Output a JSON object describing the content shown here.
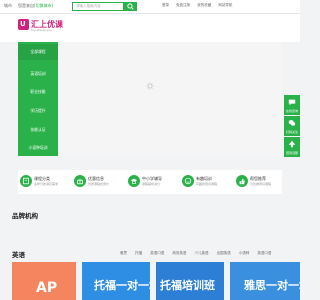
{
  "topbar": {
    "city": "城市",
    "switch_prefix": "您是来自",
    "switch_city": "[切换城市]",
    "search_placeholder": "请输入搜索内容",
    "links": [
      "登录",
      "免费注册",
      "我的收藏",
      "网站导航"
    ]
  },
  "logo": {
    "name": "汇上优课",
    "sub": "hui shang you"
  },
  "sidebar": {
    "items": [
      {
        "label": "全部课程",
        "active": true
      },
      {
        "label": "英语培训"
      },
      {
        "label": "职业技能"
      },
      {
        "label": "学历提升"
      },
      {
        "label": "技能认证"
      },
      {
        "label": "小语种培训"
      }
    ]
  },
  "float_bar": {
    "items": [
      {
        "label": "在线咨询",
        "icon": "chat-icon"
      },
      {
        "label": "扫码关注",
        "icon": "wechat-icon"
      },
      {
        "label": "回到顶部",
        "icon": "arrow-up-icon"
      }
    ]
  },
  "features": [
    {
      "title": "课程分类",
      "desc": "多样分类满足需求",
      "icon": "book-icon"
    },
    {
      "title": "优惠信息",
      "desc": "优质课程优惠价",
      "icon": "gift-icon"
    },
    {
      "title": "中小学辅导",
      "desc": "课程辅导满分",
      "icon": "school-icon"
    },
    {
      "title": "有趣培训",
      "desc": "有趣的培训课程",
      "icon": "smile-icon"
    },
    {
      "title": "帮您推荐",
      "desc": "为您推荐好课程",
      "icon": "thumb-icon"
    }
  ],
  "brand_section": {
    "title": "品牌机构"
  },
  "english_section": {
    "title": "英语",
    "tags": [
      "雅思",
      "托福",
      "英语口语",
      "商务英语",
      "少儿英语",
      "出国英语",
      "小语种",
      "英语口语",
      "四级英语"
    ]
  },
  "cards": [
    {
      "text": "AP",
      "bg": "#f4855e"
    },
    {
      "text": "托福一对一培训班",
      "bg": "#2d8ee4"
    },
    {
      "text": "托福培训班",
      "bg": "#2d7fd6"
    },
    {
      "text": "雅思一对一培训",
      "bg": "#3a8fdf"
    }
  ],
  "colors": {
    "accent": "#2bb14a",
    "brand": "#d2207d"
  }
}
